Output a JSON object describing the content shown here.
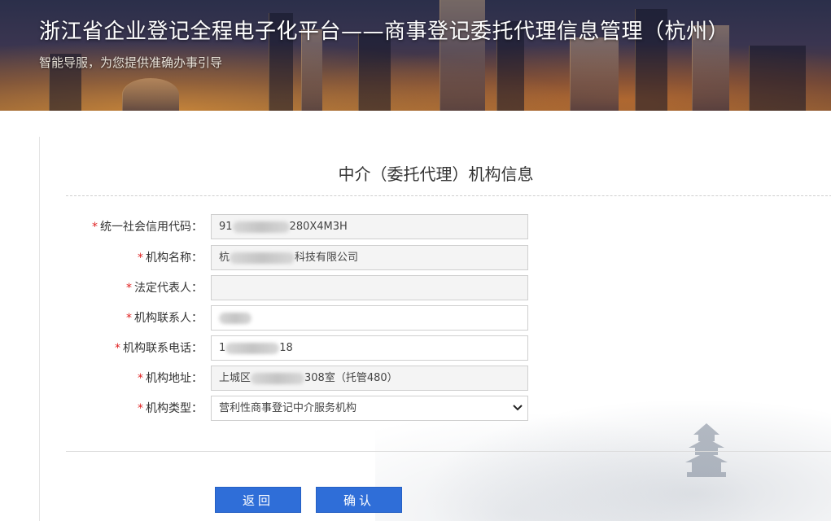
{
  "banner": {
    "title": "浙江省企业登记全程电子化平台——商事登记委托代理信息管理（杭州）",
    "subtitle": "智能导服，为您提供准确办事引导"
  },
  "form": {
    "title": "中介（委托代理）机构信息",
    "fields": [
      {
        "label": "统一社会信用代码：",
        "value_start": "91",
        "value_end": "280X4M3H",
        "required": "*"
      },
      {
        "label": "机构名称：",
        "value_start": "杭",
        "value_end": "科技有限公司",
        "required": "*"
      },
      {
        "label": "法定代表人：",
        "value_start": "",
        "value_end": "",
        "required": "*"
      },
      {
        "label": "机构联系人：",
        "value_start": "",
        "value_end": "",
        "required": "*"
      },
      {
        "label": "机构联系电话：",
        "value_start": "1",
        "value_end": "18",
        "required": "*"
      },
      {
        "label": "机构地址：",
        "value_start": "上城区",
        "value_end": "308室（托管480）",
        "required": "*"
      },
      {
        "label": "机构类型：",
        "value_start": "营利性商事登记中介服务机构",
        "value_end": "",
        "required": "*"
      }
    ]
  },
  "buttons": {
    "back_label": "返回",
    "confirm_label": "确认"
  },
  "colors": {
    "primary_button": "#2f6ed8",
    "required_mark": "#e02020"
  }
}
